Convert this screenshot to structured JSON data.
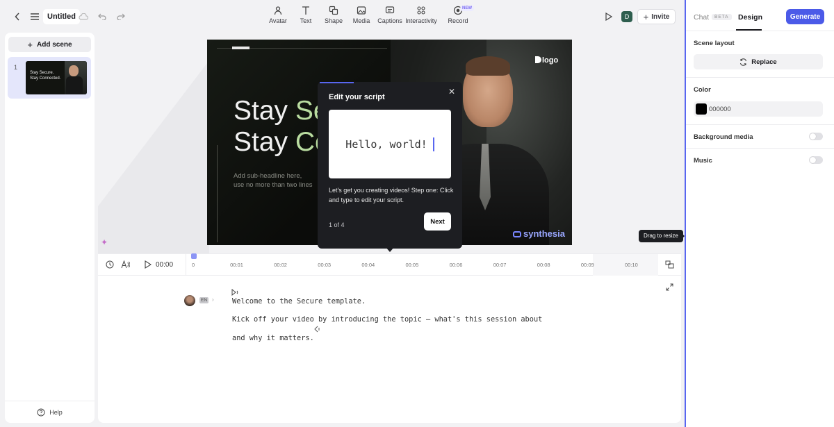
{
  "header": {
    "title": "Untitled",
    "tools": [
      {
        "label": "Avatar",
        "icon": "avatar-icon"
      },
      {
        "label": "Text",
        "icon": "text-icon"
      },
      {
        "label": "Shape",
        "icon": "shape-icon"
      },
      {
        "label": "Media",
        "icon": "media-icon"
      },
      {
        "label": "Captions",
        "icon": "captions-icon"
      },
      {
        "label": "Interactivity",
        "icon": "interactivity-icon"
      },
      {
        "label": "Record",
        "icon": "record-icon"
      }
    ],
    "new_badge": "NEW",
    "user_initial": "D",
    "invite_label": "Invite"
  },
  "sidebar": {
    "add_scene_label": "Add scene",
    "scenes": [
      {
        "number": "1",
        "thumb_line1": "Stay Secure.",
        "thumb_line2": "Stay Connected."
      }
    ],
    "help_label": "Help"
  },
  "video": {
    "headline_line1_white": "Stay ",
    "headline_line1_green": "Se",
    "headline_line2_white": "Stay ",
    "headline_line2_green": "Co",
    "subheadline_line1": "Add sub-headline here,",
    "subheadline_line2": "use no more than two lines",
    "logo_text": "logo",
    "watermark": "synthesia"
  },
  "popover": {
    "title": "Edit your script",
    "preview_text": "Hello, world!",
    "description": "Let's get you creating videos! Step one: Click and type to edit your script.",
    "step": "1 of 4",
    "next_label": "Next"
  },
  "tooltip": "Drag to resize",
  "timeline": {
    "current_time": "00:00",
    "ticks": [
      "0",
      "00:01",
      "00:02",
      "00:03",
      "00:04",
      "00:05",
      "00:06",
      "00:07",
      "00:08",
      "00:09",
      "00:10"
    ]
  },
  "script": {
    "language_badge": "EN",
    "line1": "Welcome to the Secure template.",
    "line2": "Kick off your video by introducing the topic – what's this session about",
    "line3": "and why it matters."
  },
  "right_panel": {
    "tab_chat": "Chat",
    "beta_badge": "BETA",
    "tab_design": "Design",
    "generate_label": "Generate",
    "scene_layout_label": "Scene layout",
    "replace_label": "Replace",
    "color_label": "Color",
    "color_value": "000000",
    "background_media_label": "Background media",
    "music_label": "Music"
  }
}
